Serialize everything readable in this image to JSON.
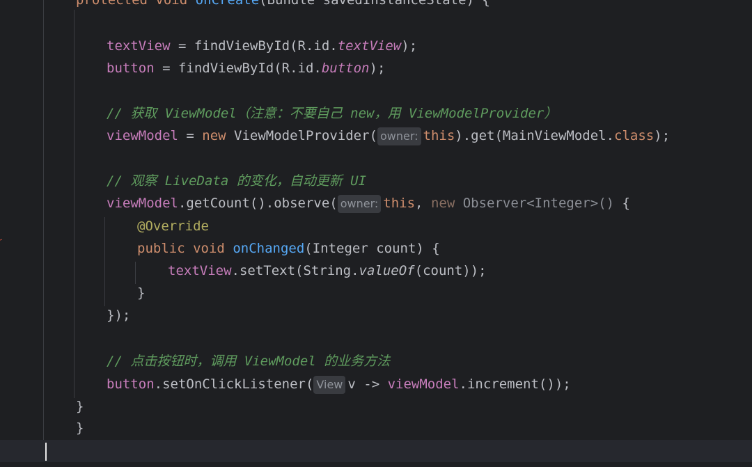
{
  "editor": {
    "language": "Java",
    "theme": {
      "background": "#1e1f22",
      "current_line": "#26282e",
      "keyword": "#cf8e6d",
      "field": "#c77dbb",
      "comment": "#5f9c5e",
      "annotation": "#b3ae60",
      "method_decl": "#56a8f5",
      "text": "#bcbec4"
    },
    "lines": [
      {
        "tokens": [
          {
            "t": "protected",
            "c": "kw"
          },
          {
            "t": " "
          },
          {
            "t": "void",
            "c": "kw"
          },
          {
            "t": " "
          },
          {
            "t": "onCreate",
            "c": "fn"
          },
          {
            "t": "(Bundle savedInstanceState) {"
          }
        ]
      },
      {
        "tokens": []
      },
      {
        "tokens": [
          {
            "t": "textView",
            "c": "fld"
          },
          {
            "t": " = findViewById(R.id."
          },
          {
            "t": "textView",
            "c": "fld-i"
          },
          {
            "t": ");"
          }
        ]
      },
      {
        "tokens": [
          {
            "t": "button",
            "c": "fld"
          },
          {
            "t": " = findViewById(R.id."
          },
          {
            "t": "button",
            "c": "fld-i"
          },
          {
            "t": ");"
          }
        ]
      },
      {
        "tokens": []
      },
      {
        "tokens": [
          {
            "t": "// 获取 ViewModel（注意：不要自己 new，用 ViewModelProvider）",
            "c": "cmt"
          }
        ]
      },
      {
        "tokens": [
          {
            "t": "viewModel",
            "c": "fld"
          },
          {
            "t": " = "
          },
          {
            "t": "new",
            "c": "kw"
          },
          {
            "t": " ViewModelProvider("
          },
          {
            "t": "owner:",
            "c": "hint"
          },
          {
            "t": "this",
            "c": "kw"
          },
          {
            "t": ").get(MainViewModel."
          },
          {
            "t": "class",
            "c": "kw"
          },
          {
            "t": ");"
          }
        ]
      },
      {
        "tokens": []
      },
      {
        "tokens": [
          {
            "t": "// 观察 LiveData 的变化，自动更新 UI",
            "c": "cmt"
          }
        ]
      },
      {
        "tokens": [
          {
            "t": "viewModel",
            "c": "fld"
          },
          {
            "t": ".getCount().observe("
          },
          {
            "t": "owner:",
            "c": "hint"
          },
          {
            "t": "this",
            "c": "kw"
          },
          {
            "t": ", "
          },
          {
            "t": "new",
            "c": "kw-dim"
          },
          {
            "t": " Observer<Integer>()",
            "c": "dim"
          },
          {
            "t": " {"
          }
        ]
      },
      {
        "tokens": [
          {
            "t": "@Override",
            "c": "ann"
          }
        ]
      },
      {
        "tokens": [
          {
            "t": "public",
            "c": "kw"
          },
          {
            "t": " "
          },
          {
            "t": "void",
            "c": "kw"
          },
          {
            "t": " "
          },
          {
            "t": "onChanged",
            "c": "fn"
          },
          {
            "t": "(Integer count) {"
          }
        ]
      },
      {
        "tokens": [
          {
            "t": "textView",
            "c": "fld"
          },
          {
            "t": ".setText(String."
          },
          {
            "t": "valueOf",
            "c": "it"
          },
          {
            "t": "(count));"
          }
        ]
      },
      {
        "tokens": [
          {
            "t": "}"
          }
        ]
      },
      {
        "tokens": [
          {
            "t": "});"
          }
        ]
      },
      {
        "tokens": []
      },
      {
        "tokens": [
          {
            "t": "// 点击按钮时，调用 ViewModel 的业务方法",
            "c": "cmt"
          }
        ]
      },
      {
        "tokens": [
          {
            "t": "button",
            "c": "fld"
          },
          {
            "t": ".setOnClickListener("
          },
          {
            "t": "View",
            "c": "hint"
          },
          {
            "t": "v -> "
          },
          {
            "t": "viewModel",
            "c": "fld"
          },
          {
            "t": ".increment());"
          }
        ]
      },
      {
        "tokens": [
          {
            "t": "}"
          }
        ]
      },
      {
        "tokens": [
          {
            "t": "}"
          }
        ]
      },
      {
        "tokens": []
      }
    ]
  }
}
